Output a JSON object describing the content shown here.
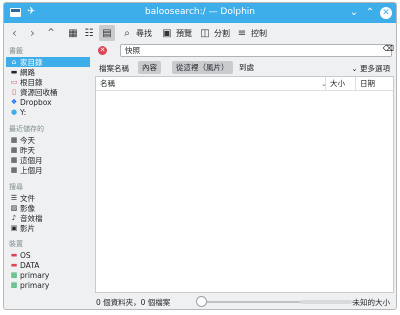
{
  "window": {
    "title": "baloosearch:/ — Dolphin"
  },
  "toolbar": {
    "search_label": "尋找",
    "preview_label": "預覽",
    "split_label": "分割",
    "control_label": "控制"
  },
  "sidebar": {
    "sections": [
      {
        "label": "書籤"
      },
      {
        "label": "最近儲存的"
      },
      {
        "label": "搜尋"
      },
      {
        "label": "裝置"
      }
    ],
    "places": [
      {
        "label": "家目錄",
        "icon": "home-icon"
      },
      {
        "label": "網路",
        "icon": "network-icon"
      },
      {
        "label": "根目錄",
        "icon": "root-folder-icon"
      },
      {
        "label": "資源回收桶",
        "icon": "trash-icon"
      },
      {
        "label": "Dropbox",
        "icon": "dropbox-icon"
      },
      {
        "label": "Y:",
        "icon": "drive-icon"
      }
    ],
    "recent": [
      {
        "label": "今天",
        "icon": "calendar-icon"
      },
      {
        "label": "昨天",
        "icon": "calendar-icon"
      },
      {
        "label": "這個月",
        "icon": "calendar-icon"
      },
      {
        "label": "上個月",
        "icon": "calendar-icon"
      }
    ],
    "search": [
      {
        "label": "文件",
        "icon": "document-icon"
      },
      {
        "label": "影像",
        "icon": "image-icon"
      },
      {
        "label": "音效檔",
        "icon": "audio-icon"
      },
      {
        "label": "影片",
        "icon": "video-icon"
      }
    ],
    "devices": [
      {
        "label": "OS",
        "icon": "drive-icon"
      },
      {
        "label": "DATA",
        "icon": "drive-icon"
      },
      {
        "label": "primary",
        "icon": "disk-icon"
      },
      {
        "label": "primary",
        "icon": "disk-icon"
      }
    ]
  },
  "filter": {
    "value": "快照"
  },
  "search_options": {
    "label": "檔案名稱",
    "content": "內容",
    "from_here": "從這裡（風片）",
    "everywhere": "到處",
    "more": "更多選項"
  },
  "columns": {
    "name": "名稱",
    "size": "大小",
    "date": "日期"
  },
  "status": {
    "text": "0 個資料夾，0 個檔案",
    "free": "未知的大小"
  },
  "colors": {
    "accent": "#3daee9",
    "window_bg": "#eff0f1",
    "close_red": "#da4453"
  }
}
